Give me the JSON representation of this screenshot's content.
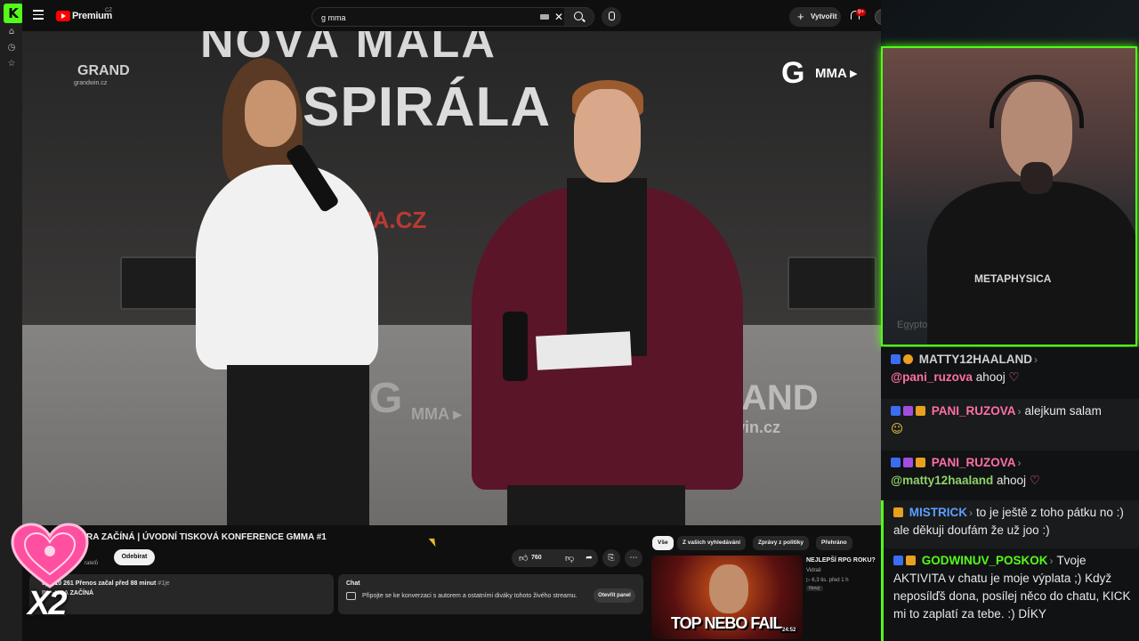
{
  "browser": {
    "rail_icons": [
      "kick-logo",
      "home-icon",
      "history-icon",
      "star-icon"
    ]
  },
  "topbar": {
    "brand": "Premium",
    "brand_region": "CZ",
    "search_value": "g mma",
    "create_label": "Vytvořit",
    "notifications_badge": "9+"
  },
  "video": {
    "banner_top": "NOVÁ MALÁ",
    "banner_main": "SPIRÁLA",
    "banner_url": "MA.CZ",
    "logo_grand": "GRAND",
    "logo_grand_url": "grandwin.cz",
    "logo_g": "G",
    "logo_mma": "MMA ▸",
    "desk_logo_g": "G",
    "desk_logo_mma": "MMA ▸",
    "desk_logo_grand": "GRAND",
    "desk_logo_grand_url": "grandwin.cz",
    "paper_accent": "#e9e9e9"
  },
  "info": {
    "title": "RA ZAČÍNÁ | ÚVODNÍ TISKOVÁ KONFERENCE GMMA #1",
    "subscriber_suffix": "ratelů",
    "subscribe_label": "Odebírat",
    "like_count": "760",
    "desc_stats": "uje: 10 261  Přenos začal před 88 minut",
    "desc_tag": "#1je",
    "desc_line": "IN – HRA ZAČÍNÁ",
    "chat_title": "Chat",
    "chat_desc": "Připojte se ke konverzaci s autorem a ostatními diváky tohoto živého streamu.",
    "open_panel": "Otevřít panel"
  },
  "overlay": {
    "multiplier": "X2",
    "heart_color": "#ff4fa0"
  },
  "recommendations": {
    "chips": [
      "Vše",
      "Z vašich vyhledávání",
      "Zprávy z politiky",
      "Přehráno"
    ],
    "active_chip": "Vše",
    "item": {
      "thumb_text": "TOP NEBO FAIL",
      "duration": "24:52",
      "title": "NEJLEPŠÍ RPG ROKU?",
      "channel": "Vidrail",
      "meta": "▷ 6,3 tis.   před 1 h",
      "badge": "Nový"
    }
  },
  "webcam": {
    "shirt_print": "METAPHYSICA",
    "faded_chat": "Egypto"
  },
  "chat": {
    "accent": "#53fc18",
    "messages": [
      {
        "user": "MATTY12HAALAND",
        "user_color": "#d0d0d0",
        "mention": "@pani_ruzova",
        "mention_color": "#ff6fa8",
        "text": " ahooj",
        "emote": "♡"
      },
      {
        "user": "PANI_RUZOVA",
        "user_color": "#ff6fa8",
        "mention": "",
        "mention_color": "",
        "text": "alejkum salam",
        "emote": "☺"
      },
      {
        "user": "PANI_RUZOVA",
        "user_color": "#ff6fa8",
        "mention": "@matty12haaland",
        "mention_color": "#8fd16a",
        "text": " ahooj",
        "emote": "♡"
      },
      {
        "user": "MISTRICK",
        "user_color": "#5aa0ff",
        "mention": "",
        "mention_color": "",
        "text": "to je ještě z toho pátku no :) ale děkuji doufám že už joo :)",
        "emote": ""
      },
      {
        "user": "GODWINUV_POSKOK",
        "user_color": "#53fc18",
        "mention": "",
        "mention_color": "",
        "text": "Tvoje AKTIVITA v chatu je moje výplata ;) Když neposílďš dona, posílej něco do chatu, KICK mi to zaplatí za tebe. :) DÍKY",
        "emote": ""
      }
    ]
  }
}
